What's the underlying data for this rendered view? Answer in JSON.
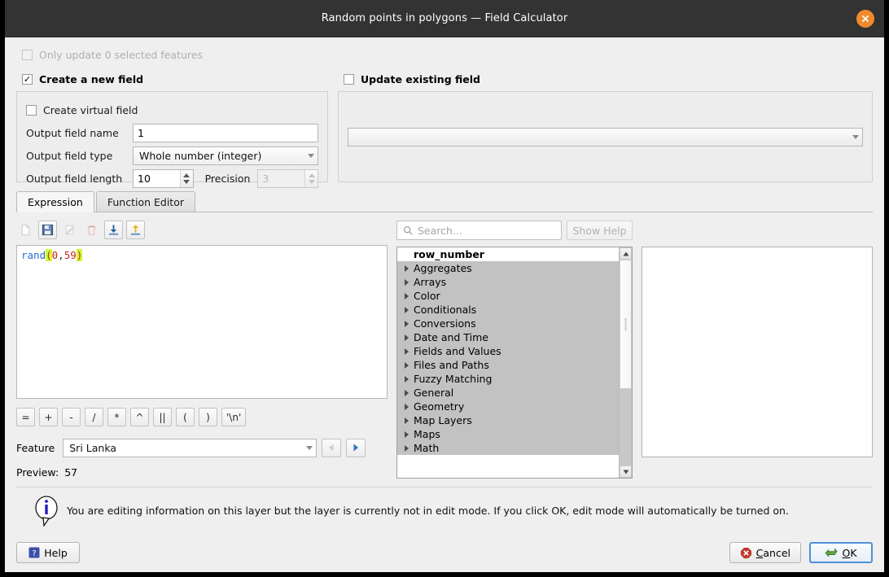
{
  "window": {
    "title": "Random points in polygons — Field Calculator",
    "close_icon": "close-icon"
  },
  "options": {
    "only_update_label": "Only update 0 selected features",
    "create_new_field_label": "Create a new field",
    "update_existing_field_label": "Update existing field",
    "create_virtual_field_label": "Create virtual field"
  },
  "new_field": {
    "name_label": "Output field name",
    "name_value": "1",
    "type_label": "Output field type",
    "type_value": "Whole number (integer)",
    "length_label": "Output field length",
    "length_value": "10",
    "precision_label": "Precision",
    "precision_value": "3"
  },
  "update_field": {
    "combo_value": ""
  },
  "tabs": [
    {
      "label": "Expression",
      "active": true
    },
    {
      "label": "Function Editor",
      "active": false
    }
  ],
  "expression_toolbar": [
    {
      "name": "new-expression-icon",
      "enabled": false
    },
    {
      "name": "save-expression-icon",
      "enabled": true
    },
    {
      "name": "edit-expression-icon",
      "enabled": false
    },
    {
      "name": "delete-expression-icon",
      "enabled": false
    },
    {
      "name": "import-expressions-icon",
      "enabled": true
    },
    {
      "name": "export-expressions-icon",
      "enabled": true
    }
  ],
  "expression": {
    "text": "rand(0,59)",
    "fn": "rand",
    "open_paren": "(",
    "arg1": "0",
    "comma": ",",
    "arg2": "59",
    "close_paren": ")"
  },
  "operators": [
    "=",
    "+",
    "-",
    "/",
    "*",
    "^",
    "||",
    "(",
    ")",
    "'\\n'"
  ],
  "feature": {
    "label": "Feature",
    "value": "Sri Lanka",
    "prev_icon": "previous-feature-icon",
    "next_icon": "next-feature-icon"
  },
  "preview": {
    "label": "Preview:",
    "value": "57"
  },
  "function_search": {
    "placeholder": "Search...",
    "value": "",
    "icon": "search-icon",
    "show_help_label": "Show Help"
  },
  "function_list": [
    {
      "label": "row_number",
      "expandable": false,
      "header": true
    },
    {
      "label": "Aggregates",
      "expandable": true,
      "header": false
    },
    {
      "label": "Arrays",
      "expandable": true,
      "header": false
    },
    {
      "label": "Color",
      "expandable": true,
      "header": false
    },
    {
      "label": "Conditionals",
      "expandable": true,
      "header": false
    },
    {
      "label": "Conversions",
      "expandable": true,
      "header": false
    },
    {
      "label": "Date and Time",
      "expandable": true,
      "header": false
    },
    {
      "label": "Fields and Values",
      "expandable": true,
      "header": false
    },
    {
      "label": "Files and Paths",
      "expandable": true,
      "header": false
    },
    {
      "label": "Fuzzy Matching",
      "expandable": true,
      "header": false
    },
    {
      "label": "General",
      "expandable": true,
      "header": false
    },
    {
      "label": "Geometry",
      "expandable": true,
      "header": false
    },
    {
      "label": "Map Layers",
      "expandable": true,
      "header": false
    },
    {
      "label": "Maps",
      "expandable": true,
      "header": false
    },
    {
      "label": "Math",
      "expandable": true,
      "header": false
    }
  ],
  "info": {
    "icon": "info-icon",
    "message": "You are editing information on this layer but the layer is currently not in edit mode. If you click OK, edit mode will automatically be turned on."
  },
  "footer": {
    "help_label": "Help",
    "cancel_label": "Cancel",
    "ok_label": "OK"
  },
  "colors": {
    "titlebar": "#333333",
    "close_button": "#ef8b2c",
    "dialog_bg": "#efefef",
    "selection_grey": "#c2c2c2",
    "focus_blue": "#4f8fd6",
    "expr_function": "#1f6fd0",
    "expr_number": "#cc2222",
    "expr_paren_highlight": "#ccff33",
    "info_icon_blue": "#2222bb",
    "cancel_red": "#c0392b",
    "ok_green": "#5f9e3f"
  }
}
